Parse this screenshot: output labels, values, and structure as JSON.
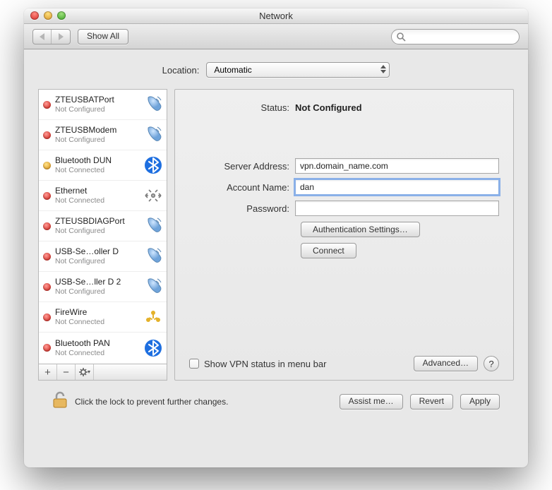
{
  "window": {
    "title": "Network"
  },
  "toolbar": {
    "show_all": "Show All",
    "search_value": ""
  },
  "location": {
    "label": "Location:",
    "value": "Automatic"
  },
  "services": [
    {
      "name": "ZTEUSBATPort",
      "status": "Not Configured",
      "dot": "red",
      "icon": "phone"
    },
    {
      "name": "ZTEUSBModem",
      "status": "Not Configured",
      "dot": "red",
      "icon": "phone"
    },
    {
      "name": "Bluetooth DUN",
      "status": "Not Connected",
      "dot": "yel",
      "icon": "bluetooth"
    },
    {
      "name": "Ethernet",
      "status": "Not Connected",
      "dot": "red",
      "icon": "ethernet"
    },
    {
      "name": "ZTEUSBDIAGPort",
      "status": "Not Configured",
      "dot": "red",
      "icon": "phone"
    },
    {
      "name": "USB-Se…oller D",
      "status": "Not Configured",
      "dot": "red",
      "icon": "phone"
    },
    {
      "name": "USB-Se…ller D 2",
      "status": "Not Configured",
      "dot": "red",
      "icon": "phone"
    },
    {
      "name": "FireWire",
      "status": "Not Connected",
      "dot": "red",
      "icon": "firewire"
    },
    {
      "name": "Bluetooth PAN",
      "status": "Not Connected",
      "dot": "red",
      "icon": "bluetooth"
    }
  ],
  "detail": {
    "status_label": "Status:",
    "status_value": "Not Configured",
    "server_label": "Server Address:",
    "server_value": "vpn.domain_name.com",
    "account_label": "Account Name:",
    "account_value": "dan",
    "password_label": "Password:",
    "password_value": "",
    "auth_button": "Authentication Settings…",
    "connect_button": "Connect",
    "menubar_label": "Show VPN status in menu bar",
    "advanced_button": "Advanced…"
  },
  "footer": {
    "lock_msg": "Click the lock to prevent further changes.",
    "assist": "Assist me…",
    "revert": "Revert",
    "apply": "Apply"
  },
  "icons": {
    "phone": "phone-handset-icon",
    "bluetooth": "bluetooth-icon",
    "ethernet": "ethernet-icon",
    "firewire": "firewire-icon"
  }
}
